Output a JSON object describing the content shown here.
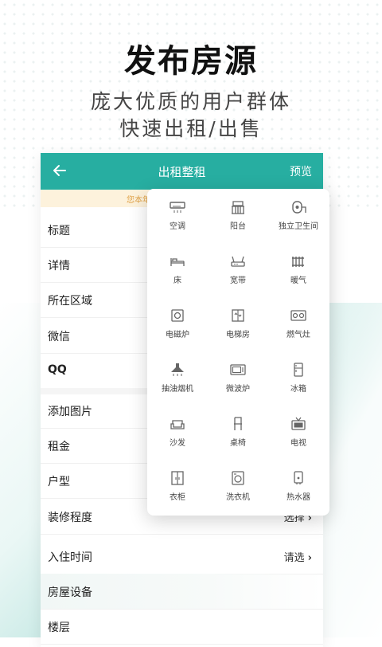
{
  "headline": "发布房源",
  "subtitle_line1": "庞大优质的用户群体",
  "subtitle_line2": "快速出租/出售",
  "appbar": {
    "title": "出租整租",
    "action": "预览"
  },
  "notice": "您本年",
  "form_rows": [
    {
      "label": "标题"
    },
    {
      "label": "详情"
    },
    {
      "label": "所在区域"
    },
    {
      "label": "微信"
    },
    {
      "label": "QQ"
    },
    {
      "label": "添加图片"
    },
    {
      "label": "租金"
    },
    {
      "label": "户型"
    },
    {
      "label": "装修程度",
      "value": "选择"
    },
    {
      "label": "入住时间",
      "value": "请选"
    },
    {
      "label": "房屋设备"
    },
    {
      "label": "楼层"
    }
  ],
  "facilities": [
    {
      "label": "空调",
      "icon": "air-conditioner-icon"
    },
    {
      "label": "阳台",
      "icon": "balcony-icon"
    },
    {
      "label": "独立卫生间",
      "icon": "toilet-paper-icon"
    },
    {
      "label": "床",
      "icon": "bed-icon"
    },
    {
      "label": "宽带",
      "icon": "router-icon"
    },
    {
      "label": "暖气",
      "icon": "radiator-icon"
    },
    {
      "label": "电磁炉",
      "icon": "induction-cooker-icon"
    },
    {
      "label": "电梯房",
      "icon": "elevator-icon"
    },
    {
      "label": "燃气灶",
      "icon": "gas-stove-icon"
    },
    {
      "label": "抽油烟机",
      "icon": "range-hood-icon"
    },
    {
      "label": "微波炉",
      "icon": "microwave-icon"
    },
    {
      "label": "冰箱",
      "icon": "fridge-icon"
    },
    {
      "label": "沙发",
      "icon": "sofa-icon"
    },
    {
      "label": "桌椅",
      "icon": "chair-icon"
    },
    {
      "label": "电视",
      "icon": "tv-icon"
    },
    {
      "label": "衣柜",
      "icon": "wardrobe-icon"
    },
    {
      "label": "洗衣机",
      "icon": "washing-machine-icon"
    },
    {
      "label": "热水器",
      "icon": "water-heater-icon"
    }
  ],
  "colors": {
    "accent": "#27aea1",
    "notice_bg": "#fdf2dc",
    "notice_text": "#e0a34a"
  }
}
